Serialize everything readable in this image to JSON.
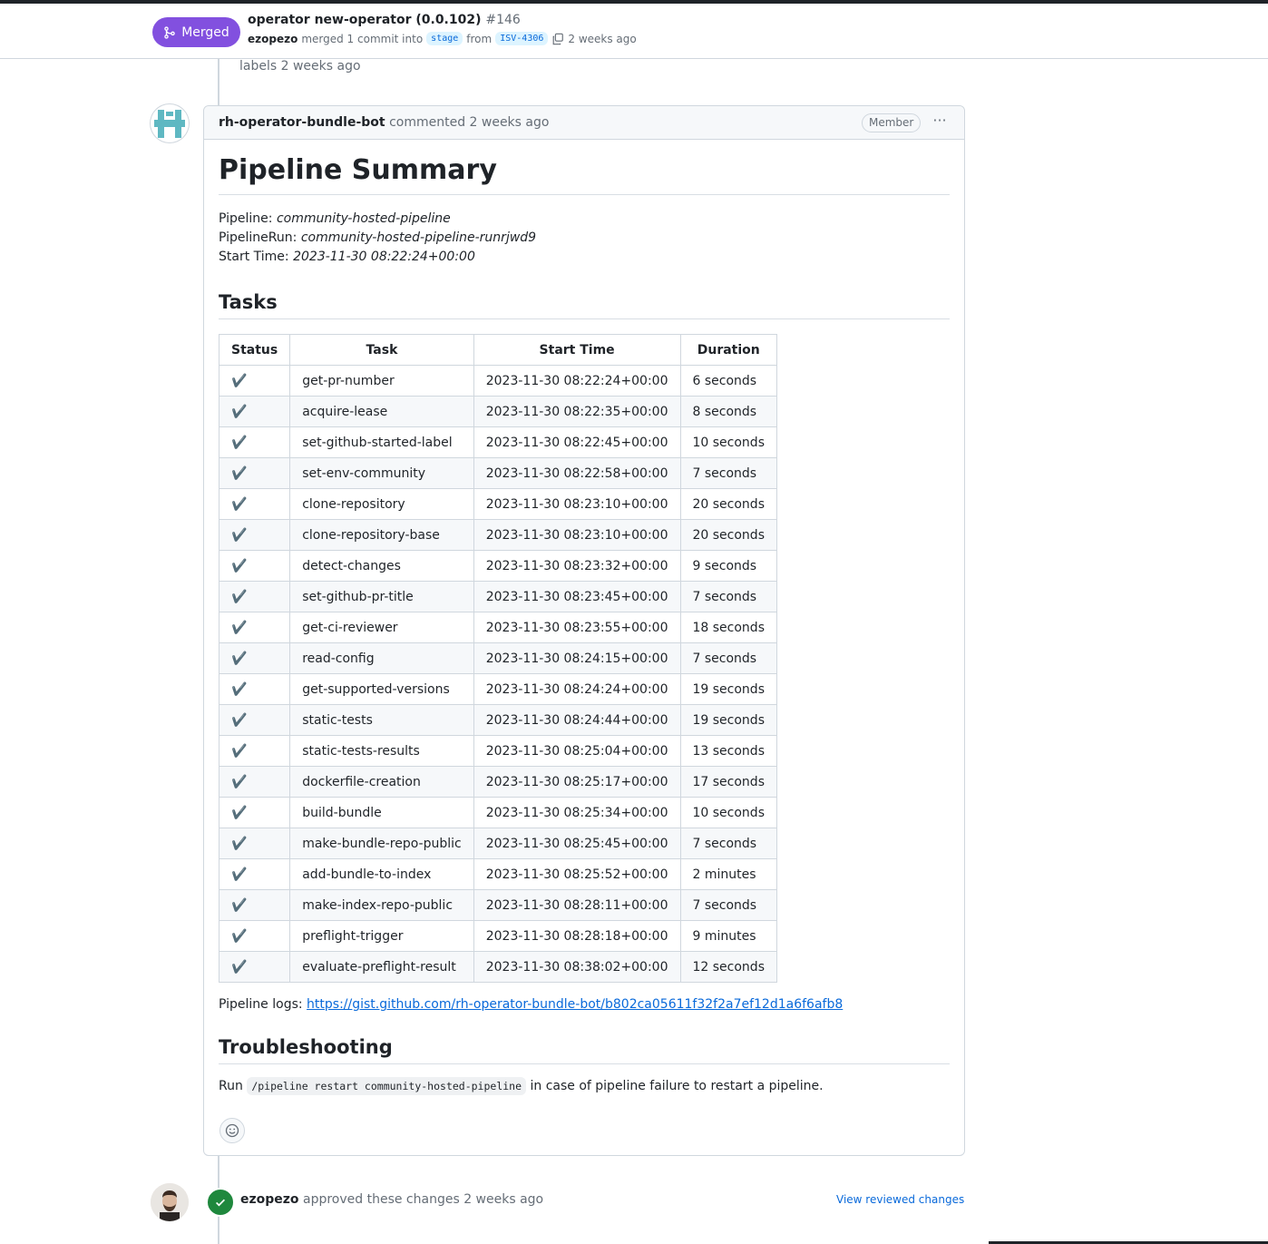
{
  "header": {
    "state_label": "Merged",
    "title": "operator new-operator (0.0.102)",
    "number": "#146",
    "author": "ezopezo",
    "merge_text": "merged 1 commit into",
    "base_branch": "stage",
    "from_text": "from",
    "head_branch": "ISV-4306",
    "time": "2 weeks ago"
  },
  "timeline": {
    "labels_event": "labels 2 weeks ago"
  },
  "comment": {
    "author": "rh-operator-bundle-bot",
    "action": "commented 2 weeks ago",
    "role_badge": "Member",
    "kebab": "···",
    "heading": "Pipeline Summary",
    "pipeline_label": "Pipeline:",
    "pipeline_value": "community-hosted-pipeline",
    "run_label": "PipelineRun:",
    "run_value": "community-hosted-pipeline-runrjwd9",
    "start_label": "Start Time:",
    "start_value": "2023-11-30 08:22:24+00:00",
    "tasks_heading": "Tasks",
    "table_headers": [
      "Status",
      "Task",
      "Start Time",
      "Duration"
    ],
    "tasks": [
      {
        "status": "✔️",
        "task": "get-pr-number",
        "start": "2023-11-30 08:22:24+00:00",
        "duration": "6 seconds"
      },
      {
        "status": "✔️",
        "task": "acquire-lease",
        "start": "2023-11-30 08:22:35+00:00",
        "duration": "8 seconds"
      },
      {
        "status": "✔️",
        "task": "set-github-started-label",
        "start": "2023-11-30 08:22:45+00:00",
        "duration": "10 seconds"
      },
      {
        "status": "✔️",
        "task": "set-env-community",
        "start": "2023-11-30 08:22:58+00:00",
        "duration": "7 seconds"
      },
      {
        "status": "✔️",
        "task": "clone-repository",
        "start": "2023-11-30 08:23:10+00:00",
        "duration": "20 seconds"
      },
      {
        "status": "✔️",
        "task": "clone-repository-base",
        "start": "2023-11-30 08:23:10+00:00",
        "duration": "20 seconds"
      },
      {
        "status": "✔️",
        "task": "detect-changes",
        "start": "2023-11-30 08:23:32+00:00",
        "duration": "9 seconds"
      },
      {
        "status": "✔️",
        "task": "set-github-pr-title",
        "start": "2023-11-30 08:23:45+00:00",
        "duration": "7 seconds"
      },
      {
        "status": "✔️",
        "task": "get-ci-reviewer",
        "start": "2023-11-30 08:23:55+00:00",
        "duration": "18 seconds"
      },
      {
        "status": "✔️",
        "task": "read-config",
        "start": "2023-11-30 08:24:15+00:00",
        "duration": "7 seconds"
      },
      {
        "status": "✔️",
        "task": "get-supported-versions",
        "start": "2023-11-30 08:24:24+00:00",
        "duration": "19 seconds"
      },
      {
        "status": "✔️",
        "task": "static-tests",
        "start": "2023-11-30 08:24:44+00:00",
        "duration": "19 seconds"
      },
      {
        "status": "✔️",
        "task": "static-tests-results",
        "start": "2023-11-30 08:25:04+00:00",
        "duration": "13 seconds"
      },
      {
        "status": "✔️",
        "task": "dockerfile-creation",
        "start": "2023-11-30 08:25:17+00:00",
        "duration": "17 seconds"
      },
      {
        "status": "✔️",
        "task": "build-bundle",
        "start": "2023-11-30 08:25:34+00:00",
        "duration": "10 seconds"
      },
      {
        "status": "✔️",
        "task": "make-bundle-repo-public",
        "start": "2023-11-30 08:25:45+00:00",
        "duration": "7 seconds"
      },
      {
        "status": "✔️",
        "task": "add-bundle-to-index",
        "start": "2023-11-30 08:25:52+00:00",
        "duration": "2 minutes"
      },
      {
        "status": "✔️",
        "task": "make-index-repo-public",
        "start": "2023-11-30 08:28:11+00:00",
        "duration": "7 seconds"
      },
      {
        "status": "✔️",
        "task": "preflight-trigger",
        "start": "2023-11-30 08:28:18+00:00",
        "duration": "9 minutes"
      },
      {
        "status": "✔️",
        "task": "evaluate-preflight-result",
        "start": "2023-11-30 08:38:02+00:00",
        "duration": "12 seconds"
      }
    ],
    "logs_label": "Pipeline logs:",
    "logs_url": "https://gist.github.com/rh-operator-bundle-bot/b802ca05611f32f2a7ef12d1a6f6afb8",
    "trouble_heading": "Troubleshooting",
    "trouble_run": "Run",
    "trouble_code": "/pipeline restart community-hosted-pipeline",
    "trouble_rest": "in case of pipeline failure to restart a pipeline."
  },
  "review": {
    "author": "ezopezo",
    "action": "approved these changes 2 weeks ago",
    "view_link": "View reviewed changes"
  },
  "colors": {
    "merged": "#8250df",
    "approved": "#1f883d",
    "link": "#0969da",
    "bot_avatar": "#5fb8c2"
  }
}
